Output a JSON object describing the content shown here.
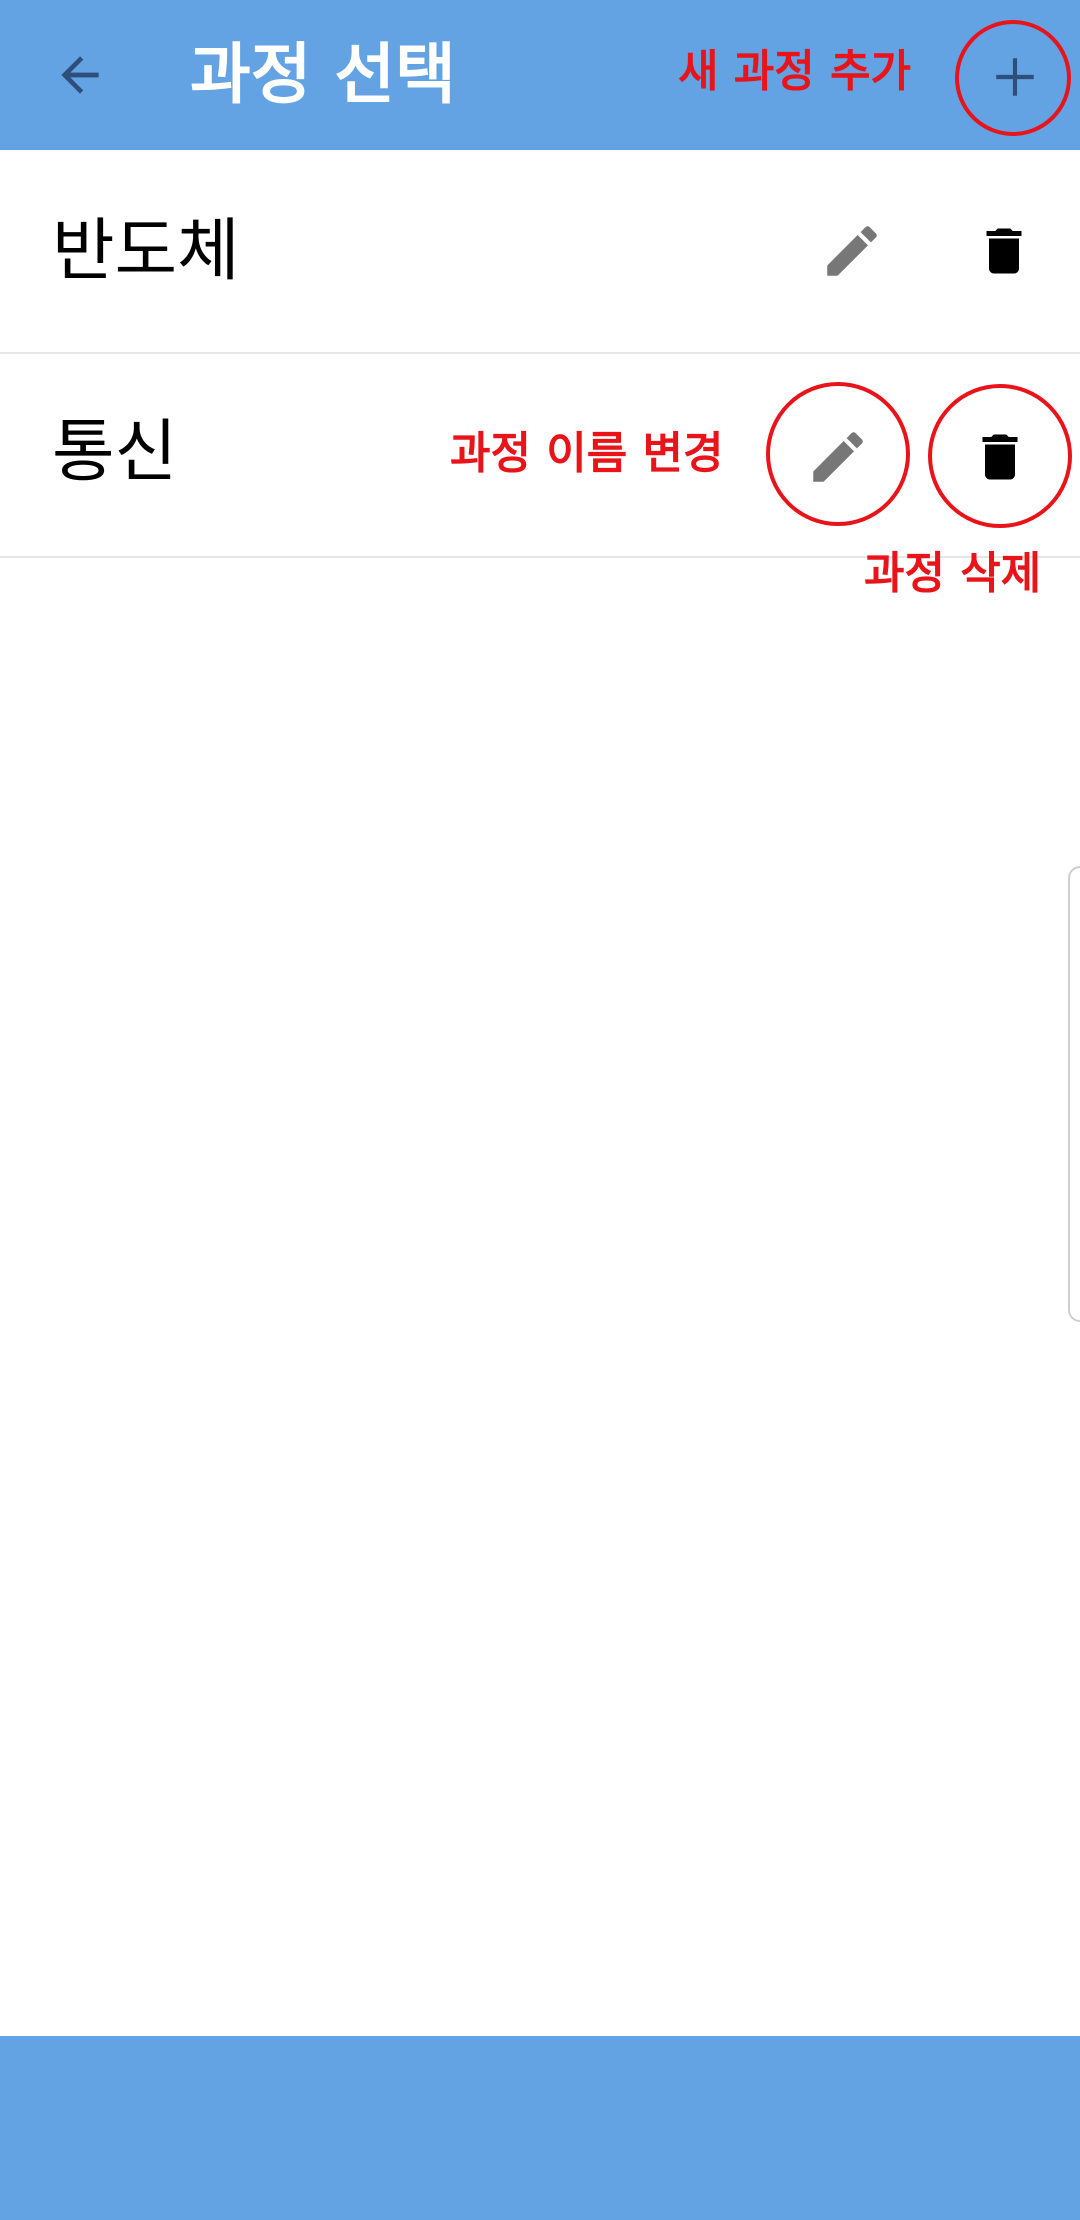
{
  "app_bar": {
    "title": "과정 선택",
    "back_icon": "arrow-left-icon",
    "add_icon": "plus-icon",
    "color": "#63a2e3"
  },
  "courses": [
    {
      "name": "반도체",
      "edit_icon": "pencil-icon",
      "delete_icon": "trash-icon"
    },
    {
      "name": "통신",
      "edit_icon": "pencil-icon",
      "delete_icon": "trash-icon"
    }
  ],
  "annotations": {
    "add_course": "새 과정 추가",
    "rename_course": "과정 이름 변경",
    "delete_course": "과정 삭제",
    "color": "#e8141a"
  }
}
